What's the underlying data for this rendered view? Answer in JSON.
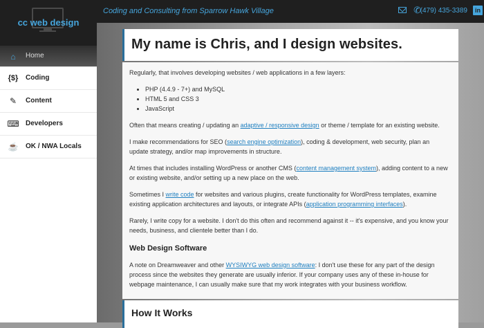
{
  "brand": {
    "logo_text": "cc web design"
  },
  "header": {
    "tagline": "Coding and Consulting from Sparrow Hawk Village",
    "phone": "(479) 435-3389",
    "icons": [
      "mail-icon",
      "phone-icon",
      "linkedin-icon"
    ],
    "linkedin_glyph": "in"
  },
  "sidebar": {
    "items": [
      {
        "label": "Home",
        "icon": "home-icon",
        "glyph": "⌂"
      },
      {
        "label": "Coding",
        "icon": "code-braces-icon",
        "glyph": "{$}"
      },
      {
        "label": "Content",
        "icon": "edit-icon",
        "glyph": "✎"
      },
      {
        "label": "Developers",
        "icon": "keyboard-icon",
        "glyph": "⌨"
      },
      {
        "label": "OK / NWA Locals",
        "icon": "coffee-cup-icon",
        "glyph": "☕"
      }
    ]
  },
  "main": {
    "title": "My name is Chris, and I design websites.",
    "intro": "Regularly, that involves developing websites / web applications in a few layers:",
    "layers": [
      "PHP (4.4.9 - 7+) and MySQL",
      "HTML 5 and CSS 3",
      "JavaScript"
    ],
    "p2": {
      "before": "Often that means creating / updating an ",
      "link": "adaptive / responsive design",
      "after": " or theme / template for an existing website."
    },
    "p3": {
      "before": "I make recommendations for SEO (",
      "link": "search engine optimization",
      "after": "), coding & development, web security, plan an update strategy, and/or map improvements in structure."
    },
    "p4": {
      "before": "At times that includes installing WordPress or another CMS (",
      "link": "content management system",
      "after": "), adding content to a new or existing website, and/or setting up a new place on the web."
    },
    "p5": {
      "before": "Sometimes I ",
      "link1": "write code",
      "middle": " for websites and various plugins, create functionality for WordPress templates, examine existing application architectures and layouts, or integrate APIs (",
      "link2": "application programming interfaces",
      "after": ")."
    },
    "p6": "Rarely, I write copy for a website. I don't do this often and recommend against it -- it's expensive, and you know your needs, business, and clientele better than I do.",
    "software_heading": "Web Design Software",
    "p7": {
      "before": "A note on Dreamweaver and other ",
      "link": "WYSIWYG web design software",
      "after": ": I don't use these for any part of the design process since the websites they generate are usually inferior. If your company uses any of these in-house for webpage maintenance, I can usually make sure that my work integrates with your business workflow."
    },
    "how_heading": "How It Works"
  },
  "colors": {
    "accent": "#46a5dc",
    "dark": "#1f1f1f",
    "link": "#1e7fc0",
    "panel_border": "#2a6f9b"
  }
}
